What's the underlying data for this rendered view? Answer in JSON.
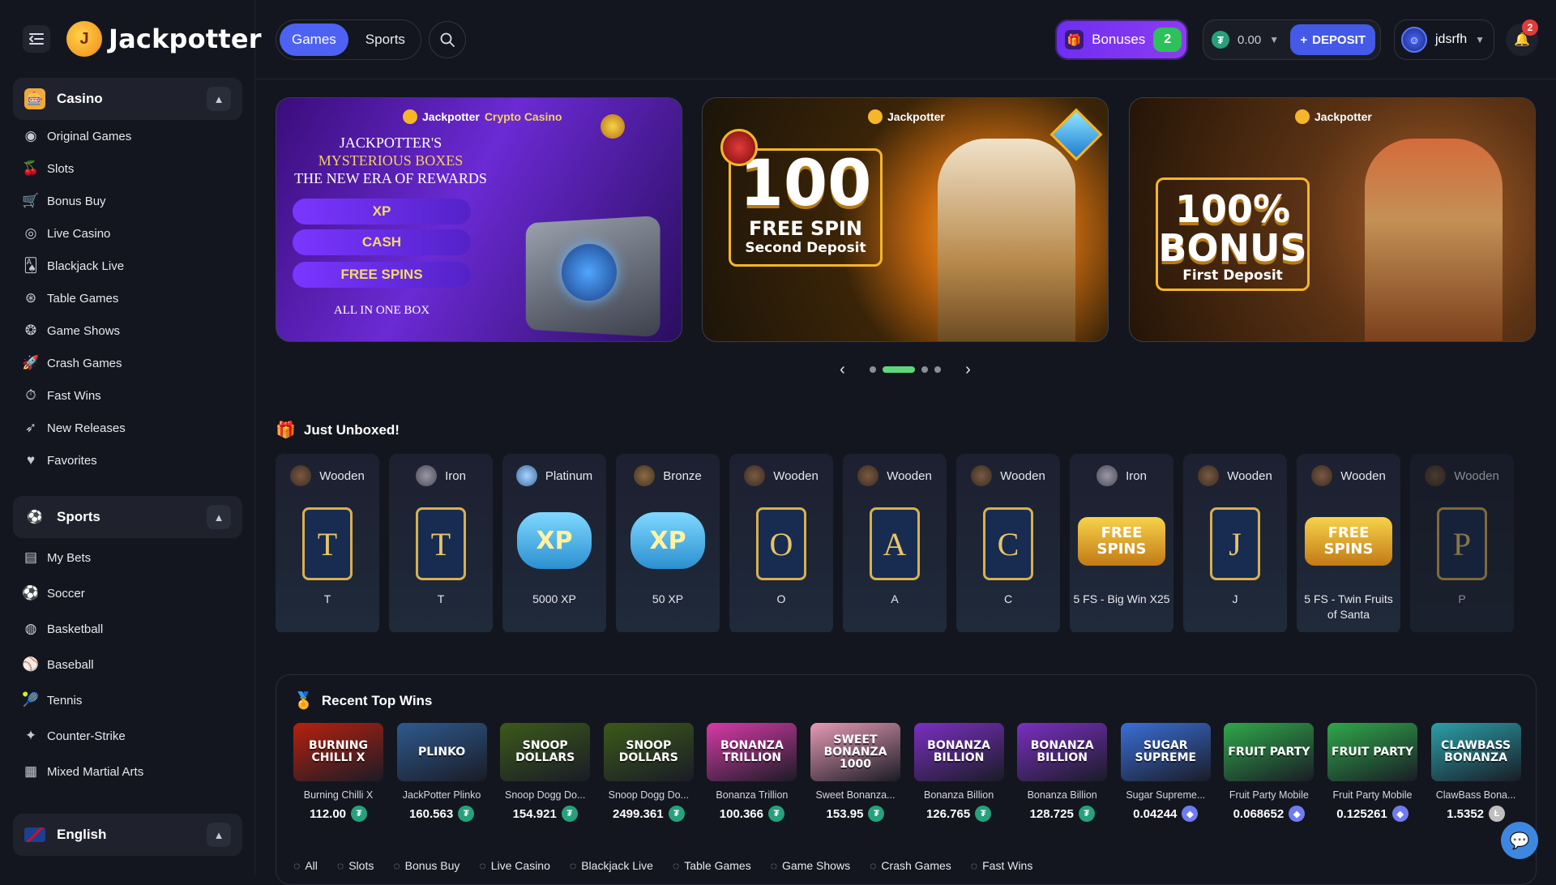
{
  "brand": {
    "name": "Jackpotter"
  },
  "sidebar": {
    "casino": {
      "title": "Casino",
      "items": [
        {
          "label": "Original Games",
          "icon": "original-games-icon"
        },
        {
          "label": "Slots",
          "icon": "slots-icon"
        },
        {
          "label": "Bonus Buy",
          "icon": "cart-icon"
        },
        {
          "label": "Live Casino",
          "icon": "live-icon"
        },
        {
          "label": "Blackjack Live",
          "icon": "cards-icon"
        },
        {
          "label": "Table Games",
          "icon": "chip-icon"
        },
        {
          "label": "Game Shows",
          "icon": "wheel-icon"
        },
        {
          "label": "Crash Games",
          "icon": "rocket-icon"
        },
        {
          "label": "Fast Wins",
          "icon": "stopwatch-icon"
        },
        {
          "label": "New Releases",
          "icon": "rocket-launch-icon"
        },
        {
          "label": "Favorites",
          "icon": "heart-icon"
        }
      ]
    },
    "sports": {
      "title": "Sports",
      "items": [
        {
          "label": "My Bets",
          "icon": "betslip-icon"
        },
        {
          "label": "Soccer",
          "icon": "soccer-icon"
        },
        {
          "label": "Basketball",
          "icon": "basketball-icon"
        },
        {
          "label": "Baseball",
          "icon": "baseball-icon"
        },
        {
          "label": "Tennis",
          "icon": "tennis-icon"
        },
        {
          "label": "Counter-Strike",
          "icon": "counter-strike-icon"
        },
        {
          "label": "Mixed Martial Arts",
          "icon": "mma-icon"
        }
      ]
    },
    "language": {
      "label": "English",
      "flag": "uk-flag-icon"
    }
  },
  "header": {
    "tabs": [
      {
        "label": "Games",
        "active": true
      },
      {
        "label": "Sports",
        "active": false
      }
    ],
    "bonuses": {
      "label": "Bonuses",
      "count": "2"
    },
    "wallet": {
      "amount": "0.00",
      "deposit_label": "DEPOSIT",
      "currency_icon": "tether-icon"
    },
    "user": {
      "name": "jdsrfh"
    },
    "notifications": {
      "count": "2"
    }
  },
  "banners": [
    {
      "brand": "Jackpotter",
      "brand_suffix": "Crypto Casino",
      "line1": "JACKPOTTER'S",
      "line2": "MYSTERIOUS BOXES",
      "line3": "THE NEW ERA OF REWARDS",
      "pills": [
        "XP",
        "CASH",
        "FREE SPINS"
      ],
      "footer": "ALL IN ONE BOX"
    },
    {
      "brand": "Jackpotter",
      "big": "100",
      "sub1": "FREE SPIN",
      "sub2": "Second Deposit"
    },
    {
      "brand": "Jackpotter",
      "big_line1": "100%",
      "big_line2": "BONUS",
      "sub2": "First Deposit"
    }
  ],
  "carousel": {
    "active_index": 1,
    "count": 4
  },
  "unboxed": {
    "title": "Just Unboxed!",
    "items": [
      {
        "tier": "Wooden",
        "name": "T",
        "art": "card"
      },
      {
        "tier": "Iron",
        "name": "T",
        "art": "card"
      },
      {
        "tier": "Platinum",
        "name": "5000 XP",
        "art": "xp"
      },
      {
        "tier": "Bronze",
        "name": "50 XP",
        "art": "xp"
      },
      {
        "tier": "Wooden",
        "name": "O",
        "art": "card"
      },
      {
        "tier": "Wooden",
        "name": "A",
        "art": "card"
      },
      {
        "tier": "Wooden",
        "name": "C",
        "art": "card"
      },
      {
        "tier": "Iron",
        "name": "5 FS - Big Win X25",
        "art": "freespins"
      },
      {
        "tier": "Wooden",
        "name": "J",
        "art": "card"
      },
      {
        "tier": "Wooden",
        "name": "5 FS - Twin Fruits of Santa",
        "art": "freespins"
      },
      {
        "tier": "Wooden",
        "name": "P",
        "art": "card"
      }
    ],
    "art_text": {
      "xp": "XP",
      "freespins": "FREE SPINS"
    }
  },
  "wins": {
    "title": "Recent Top Wins",
    "items": [
      {
        "game": "Burning Chilli X",
        "amount": "112.00",
        "coin": "usdt",
        "thumb_text": "BURNING CHILLI X",
        "color": "#b8200e"
      },
      {
        "game": "JackPotter Plinko",
        "amount": "160.563",
        "coin": "usdt",
        "thumb_text": "PLINKO",
        "color": "#2e5a8e"
      },
      {
        "game": "Snoop Dogg Do...",
        "amount": "154.921",
        "coin": "usdt",
        "thumb_text": "SNOOP DOLLARS",
        "color": "#3c5a1a"
      },
      {
        "game": "Snoop Dogg Do...",
        "amount": "2499.361",
        "coin": "usdt",
        "thumb_text": "SNOOP DOLLARS",
        "color": "#3c5a1a"
      },
      {
        "game": "Bonanza Trillion",
        "amount": "100.366",
        "coin": "usdt",
        "thumb_text": "BONANZA TRILLION",
        "color": "#d83aa8"
      },
      {
        "game": "Sweet Bonanza...",
        "amount": "153.95",
        "coin": "usdt",
        "thumb_text": "SWEET BONANZA 1000",
        "color": "#e79ab4"
      },
      {
        "game": "Bonanza Billion",
        "amount": "126.765",
        "coin": "usdt",
        "thumb_text": "BONANZA BILLION",
        "color": "#7b2fc2"
      },
      {
        "game": "Bonanza Billion",
        "amount": "128.725",
        "coin": "usdt",
        "thumb_text": "BONANZA BILLION",
        "color": "#7b2fc2"
      },
      {
        "game": "Sugar Supreme...",
        "amount": "0.04244",
        "coin": "eth",
        "thumb_text": "SUGAR SUPREME",
        "color": "#3a6fd8"
      },
      {
        "game": "Fruit Party Mobile",
        "amount": "0.068652",
        "coin": "eth",
        "thumb_text": "FRUIT PARTY",
        "color": "#2fa84a"
      },
      {
        "game": "Fruit Party Mobile",
        "amount": "0.125261",
        "coin": "eth",
        "thumb_text": "FRUIT PARTY",
        "color": "#2fa84a"
      },
      {
        "game": "ClawBass Bona...",
        "amount": "1.5352",
        "coin": "ltc",
        "thumb_text": "CLAWBASS BONANZA",
        "color": "#2aa0a8"
      }
    ]
  },
  "categories": [
    "All",
    "Slots",
    "Bonus Buy",
    "Live Casino",
    "Blackjack Live",
    "Table Games",
    "Game Shows",
    "Crash Games",
    "Fast Wins"
  ]
}
